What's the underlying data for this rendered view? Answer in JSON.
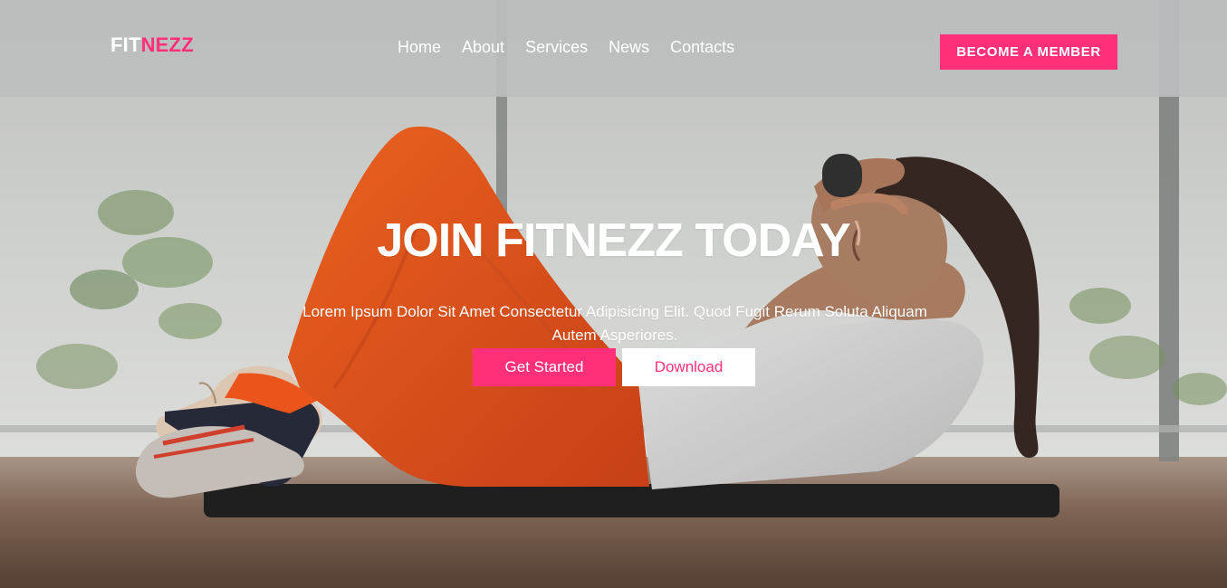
{
  "brand": {
    "prefix": "FIT",
    "accent": "NEZZ",
    "accent_color": "#ff2f79"
  },
  "nav": {
    "items": [
      "Home",
      "About",
      "Services",
      "News",
      "Contacts"
    ]
  },
  "header": {
    "cta_label": "BECOME A MEMBER"
  },
  "hero": {
    "title": "JOIN FITNEZZ TODAY",
    "subtitle": "Lorem Ipsum Dolor Sit Amet Consectetur Adipisicing Elit. Quod Fugit Rerum Soluta Aliquam Autem Asperiores.",
    "primary_label": "Get Started",
    "secondary_label": "Download"
  }
}
